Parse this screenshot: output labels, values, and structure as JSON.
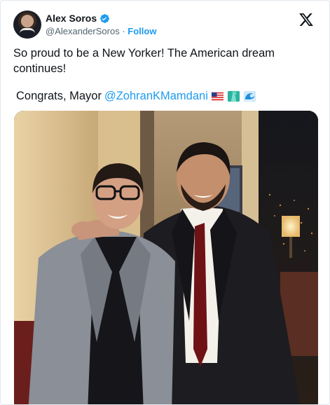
{
  "author": {
    "display_name": "Alex Soros",
    "handle": "@AlexanderSoros",
    "separator": "·",
    "follow_label": "Follow",
    "verified": true
  },
  "tweet": {
    "text": "So proud to be a New Yorker! The American dream continues!",
    "congrats_prefix": "Congrats, Mayor",
    "mention": "@ZohranKMamdani",
    "emojis": [
      "us-flag-emoji",
      "statue-of-liberty-emoji",
      "wave-emoji"
    ]
  },
  "colors": {
    "accent": "#1d9bf0",
    "text": "#0f1419",
    "muted": "#536471"
  },
  "icons": {
    "platform": "x-logo-icon",
    "verified": "verified-badge-icon"
  }
}
